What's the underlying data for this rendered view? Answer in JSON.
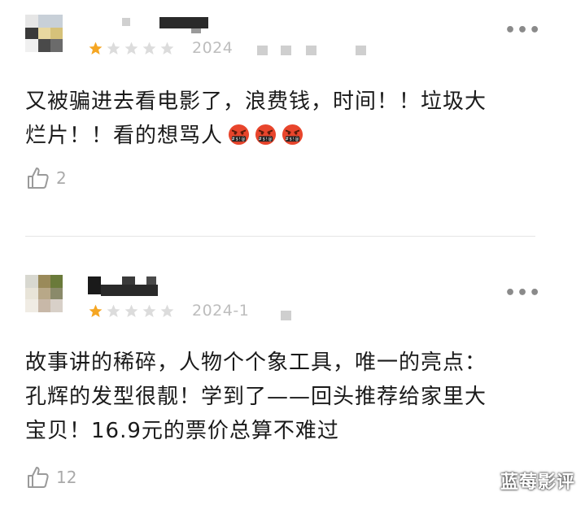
{
  "reviews": [
    {
      "date": "2024",
      "text_line1": "又被骗进去看电影了，浪费钱，时间！！垃圾大",
      "text_line2": "烂片！！看的想骂人",
      "emoji": "angry-face-with-symbols-icon",
      "rating": 1,
      "rating_max": 5,
      "likes": "2"
    },
    {
      "date": "2024-1",
      "text_line1": "故事讲的稀碎，人物个个象工具，唯一的亮点：",
      "text_line2": "孔辉的发型很靓！学到了——回头推荐给家里大",
      "text_line3": "宝贝！16.9元的票价总算不难过",
      "rating": 1,
      "rating_max": 5,
      "likes": "12"
    }
  ],
  "more_label": "•••",
  "watermark": "蓝莓影评",
  "colors": {
    "star_filled": "#f5a623",
    "star_empty": "#d9d9d9",
    "text": "#1a1a1a",
    "meta": "#bdbdbd"
  }
}
